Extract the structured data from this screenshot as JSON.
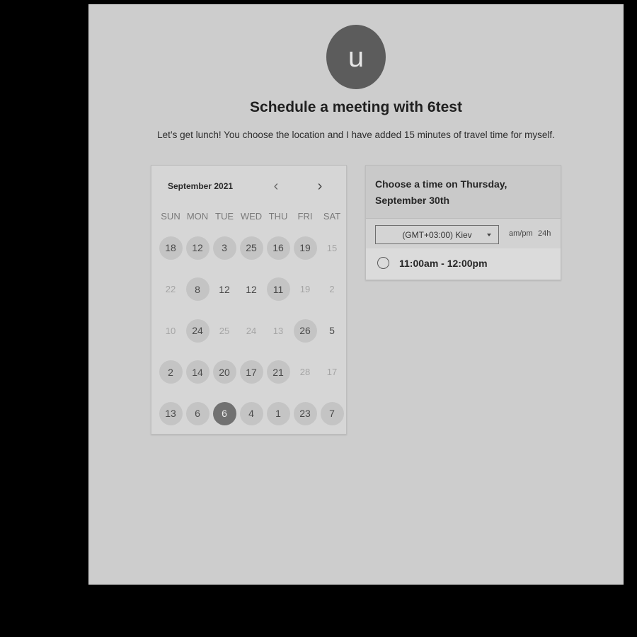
{
  "avatar": {
    "initial": "u"
  },
  "title": "Schedule a meeting with 6test",
  "subtitle": "Let’s get lunch! You choose the location and I have added 15 minutes of travel time for myself.",
  "calendar": {
    "month": "September 2021",
    "prev_icon": "‹",
    "next_icon": "›",
    "weekdays": [
      "SUN",
      "MON",
      "TUE",
      "WED",
      "THU",
      "FRI",
      "SAT"
    ],
    "days": [
      {
        "label": "18",
        "state": "avail"
      },
      {
        "label": "12",
        "state": "avail"
      },
      {
        "label": "3",
        "state": "avail"
      },
      {
        "label": "25",
        "state": "avail"
      },
      {
        "label": "16",
        "state": "avail"
      },
      {
        "label": "19",
        "state": "avail"
      },
      {
        "label": "15",
        "state": "muted"
      },
      {
        "label": "22",
        "state": "muted"
      },
      {
        "label": "8",
        "state": "avail"
      },
      {
        "label": "12",
        "state": "normal"
      },
      {
        "label": "12",
        "state": "normal"
      },
      {
        "label": "11",
        "state": "avail"
      },
      {
        "label": "19",
        "state": "muted"
      },
      {
        "label": "2",
        "state": "muted"
      },
      {
        "label": "10",
        "state": "muted"
      },
      {
        "label": "24",
        "state": "avail"
      },
      {
        "label": "25",
        "state": "muted"
      },
      {
        "label": "24",
        "state": "muted"
      },
      {
        "label": "13",
        "state": "muted"
      },
      {
        "label": "26",
        "state": "avail"
      },
      {
        "label": "5",
        "state": "normal"
      },
      {
        "label": "2",
        "state": "avail"
      },
      {
        "label": "14",
        "state": "avail"
      },
      {
        "label": "20",
        "state": "avail"
      },
      {
        "label": "17",
        "state": "avail"
      },
      {
        "label": "21",
        "state": "avail"
      },
      {
        "label": "28",
        "state": "muted"
      },
      {
        "label": "17",
        "state": "muted"
      },
      {
        "label": "13",
        "state": "avail"
      },
      {
        "label": "6",
        "state": "avail"
      },
      {
        "label": "6",
        "state": "selected"
      },
      {
        "label": "4",
        "state": "avail"
      },
      {
        "label": "1",
        "state": "avail"
      },
      {
        "label": "23",
        "state": "avail"
      },
      {
        "label": "7",
        "state": "avail"
      }
    ]
  },
  "time_panel": {
    "heading": "Choose a time on Thursday, September 30th",
    "timezone": "(GMT+03:00) Kiev",
    "format_ampm": "am/pm",
    "format_24h": "24h",
    "slots": [
      "11:00am - 12:00pm"
    ]
  },
  "colors": {
    "page_bg": "#cdcdcd",
    "avatar_bg": "#5c5c5c",
    "selected_day": "#717171"
  }
}
